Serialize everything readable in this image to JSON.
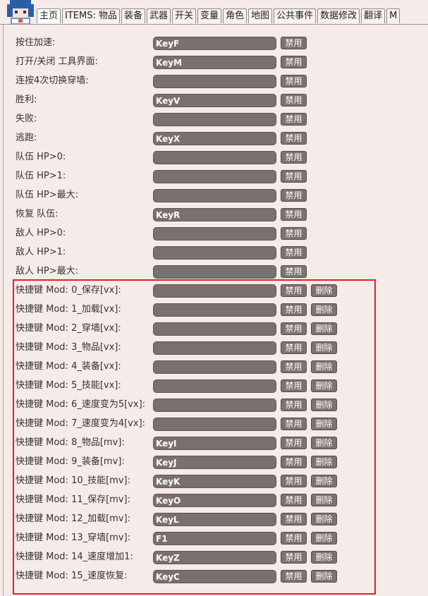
{
  "tabs": [
    "主页",
    "ITEMS: 物品",
    "装备",
    "武器",
    "开关",
    "变量",
    "角色",
    "地图",
    "公共事件",
    "数据修改",
    "翻译",
    "M"
  ],
  "labels": {
    "disable": "禁用",
    "delete": "删除"
  },
  "keybinds": [
    {
      "label": "按住加速:",
      "key": "KeyF"
    },
    {
      "label": "打开/关闭 工具界面:",
      "key": "KeyM"
    },
    {
      "label": "连按4次切换穿墙:",
      "key": ""
    },
    {
      "label": "胜利:",
      "key": "KeyV"
    },
    {
      "label": "失败:",
      "key": ""
    },
    {
      "label": "逃跑:",
      "key": "KeyX"
    },
    {
      "label": "队伍 HP>0:",
      "key": ""
    },
    {
      "label": "队伍 HP>1:",
      "key": ""
    },
    {
      "label": "队伍 HP>最大:",
      "key": ""
    },
    {
      "label": "恢复 队伍:",
      "key": "KeyR"
    },
    {
      "label": "敌人 HP>0:",
      "key": ""
    },
    {
      "label": "敌人 HP>1:",
      "key": ""
    },
    {
      "label": "敌人 HP>最大:",
      "key": ""
    }
  ],
  "mod_keybinds": [
    {
      "label": "快捷键 Mod: 0_保存[vx]:",
      "key": ""
    },
    {
      "label": "快捷键 Mod: 1_加载[vx]:",
      "key": ""
    },
    {
      "label": "快捷键 Mod: 2_穿墙[vx]:",
      "key": ""
    },
    {
      "label": "快捷键 Mod: 3_物品[vx]:",
      "key": ""
    },
    {
      "label": "快捷键 Mod: 4_装备[vx]:",
      "key": ""
    },
    {
      "label": "快捷键 Mod: 5_技能[vx]:",
      "key": ""
    },
    {
      "label": "快捷键 Mod: 6_速度变为5[vx]:",
      "key": ""
    },
    {
      "label": "快捷键 Mod: 7_速度变为4[vx]:",
      "key": ""
    },
    {
      "label": "快捷键 Mod: 8_物品[mv]:",
      "key": "KeyI"
    },
    {
      "label": "快捷键 Mod: 9_装备[mv]:",
      "key": "KeyJ"
    },
    {
      "label": "快捷键 Mod: 10_技能[mv]:",
      "key": "KeyK"
    },
    {
      "label": "快捷键 Mod: 11_保存[mv]:",
      "key": "KeyO"
    },
    {
      "label": "快捷键 Mod: 12_加载[mv]:",
      "key": "KeyL"
    },
    {
      "label": "快捷键 Mod: 13_穿墙[mv]:",
      "key": "F1"
    },
    {
      "label": "快捷键 Mod: 14_速度增加1:",
      "key": "KeyZ"
    },
    {
      "label": "快捷键 Mod: 15_速度恢复:",
      "key": "KeyC"
    }
  ],
  "colors": {
    "field_bg": "#7b7070",
    "button_bg": "#7d7272",
    "highlight_border": "#e0202a",
    "page_bg": "#f5ebe8"
  }
}
